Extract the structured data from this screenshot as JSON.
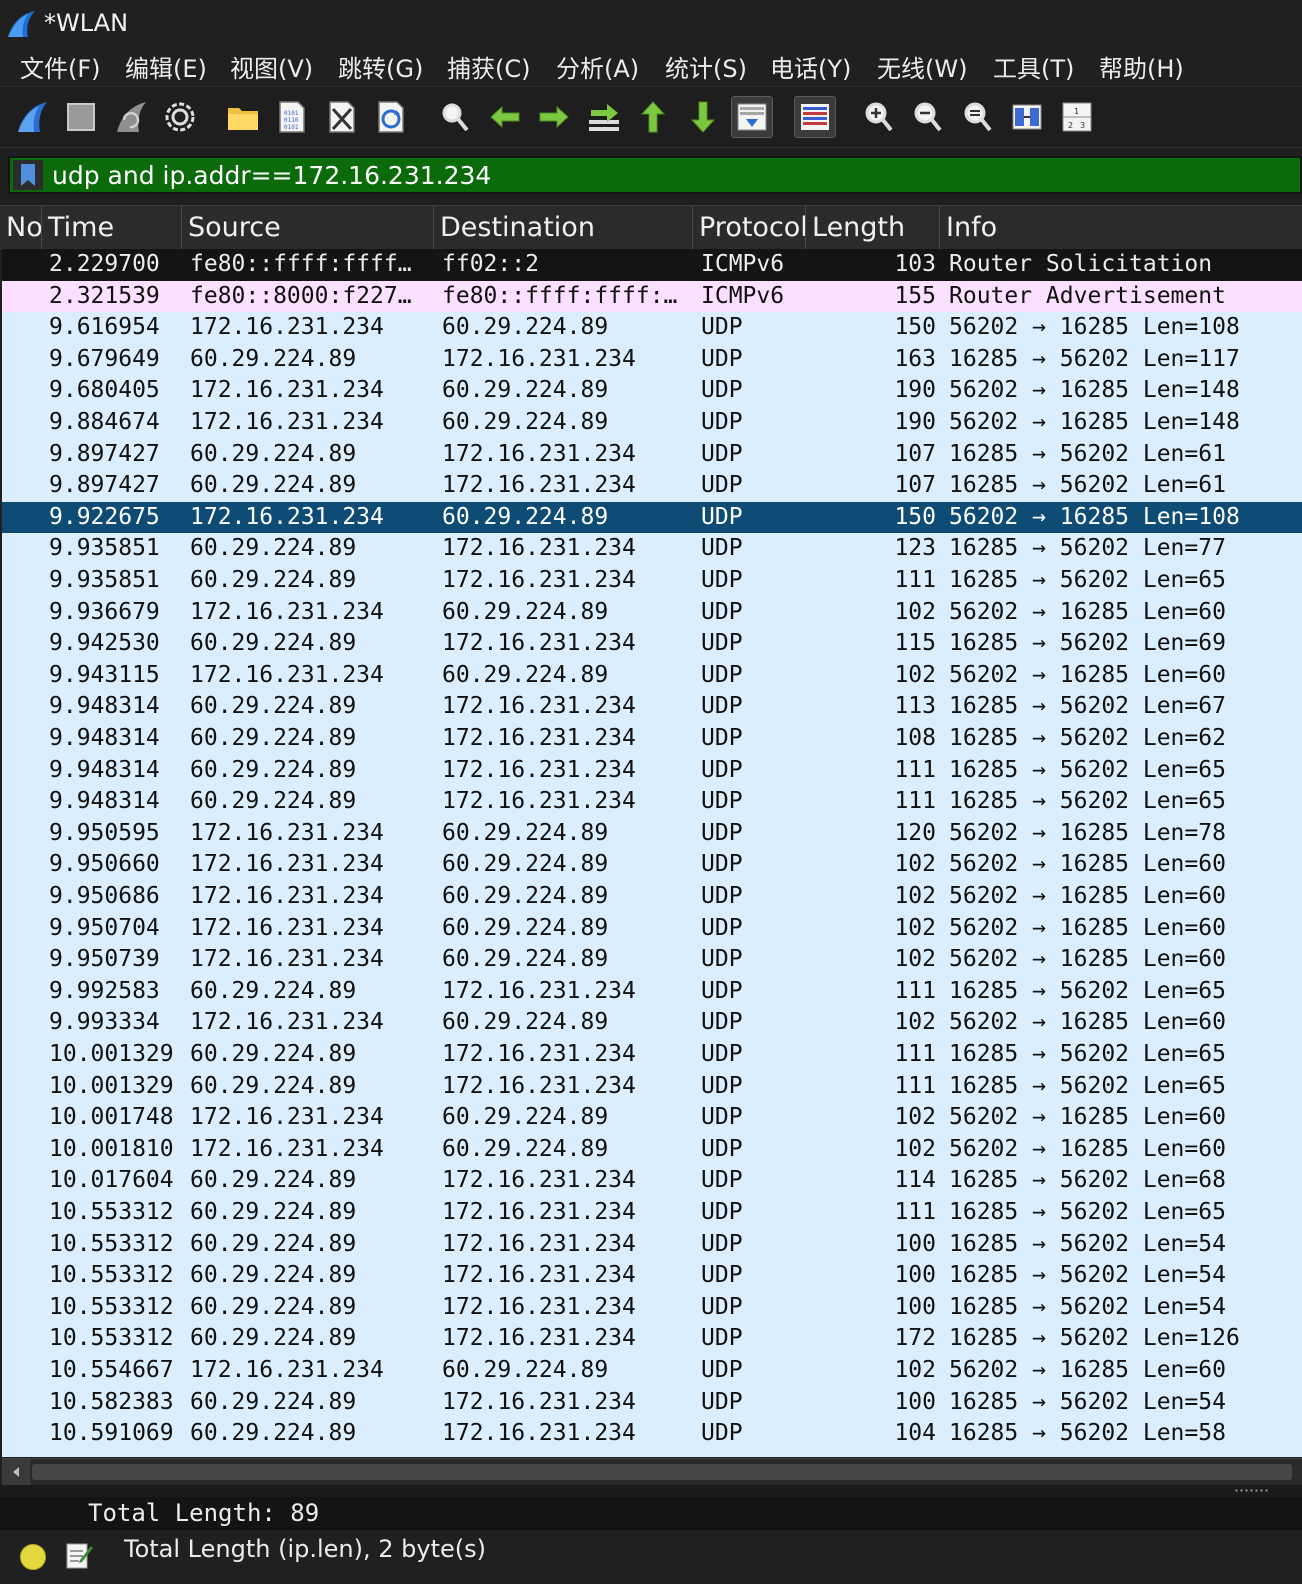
{
  "window": {
    "title": "*WLAN"
  },
  "menu": [
    "文件(F)",
    "编辑(E)",
    "视图(V)",
    "跳转(G)",
    "捕获(C)",
    "分析(A)",
    "统计(S)",
    "电话(Y)",
    "无线(W)",
    "工具(T)",
    "帮助(H)"
  ],
  "toolbar": {
    "icons": [
      "start-capture-icon",
      "stop-capture-icon",
      "restart-capture-icon",
      "capture-options-icon",
      "open-file-icon",
      "save-file-icon",
      "close-file-icon",
      "reload-file-icon",
      "find-packet-icon",
      "go-back-icon",
      "go-forward-icon",
      "go-to-packet-icon",
      "first-packet-icon",
      "last-packet-icon",
      "autoscroll-icon",
      "colorize-icon",
      "zoom-in-icon",
      "zoom-out-icon",
      "normal-size-icon",
      "resize-columns-icon",
      "packet-bytes-icon"
    ]
  },
  "filter": {
    "value": "udp and ip.addr==172.16.231.234"
  },
  "columns": {
    "no": "No",
    "time": "Time",
    "source": "Source",
    "destination": "Destination",
    "protocol": "Protocol",
    "length": "Length",
    "info": "Info"
  },
  "colors": {
    "udp_row": "#dbeefe",
    "icmp_row": "#fce0ff",
    "selected_row": "#0f4c75",
    "filter_ok": "#0b6b0b"
  },
  "packets": [
    {
      "time": "2.229700",
      "src": "fe80::ffff:ffff…",
      "dst": "ff02::2",
      "proto": "ICMPv6",
      "len": "103",
      "info": "Router Solicitation",
      "style": "dark"
    },
    {
      "time": "2.321539",
      "src": "fe80::8000:f227…",
      "dst": "fe80::ffff:ffff:…",
      "proto": "ICMPv6",
      "len": "155",
      "info": "Router Advertisement",
      "style": "icmp"
    },
    {
      "time": "9.616954",
      "src": "172.16.231.234",
      "dst": "60.29.224.89",
      "proto": "UDP",
      "len": "150",
      "info": "56202 → 16285 Len=108",
      "style": "udp"
    },
    {
      "time": "9.679649",
      "src": "60.29.224.89",
      "dst": "172.16.231.234",
      "proto": "UDP",
      "len": "163",
      "info": "16285 → 56202 Len=117",
      "style": "udp"
    },
    {
      "time": "9.680405",
      "src": "172.16.231.234",
      "dst": "60.29.224.89",
      "proto": "UDP",
      "len": "190",
      "info": "56202 → 16285 Len=148",
      "style": "udp"
    },
    {
      "time": "9.884674",
      "src": "172.16.231.234",
      "dst": "60.29.224.89",
      "proto": "UDP",
      "len": "190",
      "info": "56202 → 16285 Len=148",
      "style": "udp"
    },
    {
      "time": "9.897427",
      "src": "60.29.224.89",
      "dst": "172.16.231.234",
      "proto": "UDP",
      "len": "107",
      "info": "16285 → 56202 Len=61",
      "style": "udp"
    },
    {
      "time": "9.897427",
      "src": "60.29.224.89",
      "dst": "172.16.231.234",
      "proto": "UDP",
      "len": "107",
      "info": "16285 → 56202 Len=61",
      "style": "udp"
    },
    {
      "time": "9.922675",
      "src": "172.16.231.234",
      "dst": "60.29.224.89",
      "proto": "UDP",
      "len": "150",
      "info": "56202 → 16285 Len=108",
      "style": "selected"
    },
    {
      "time": "9.935851",
      "src": "60.29.224.89",
      "dst": "172.16.231.234",
      "proto": "UDP",
      "len": "123",
      "info": "16285 → 56202 Len=77",
      "style": "udp"
    },
    {
      "time": "9.935851",
      "src": "60.29.224.89",
      "dst": "172.16.231.234",
      "proto": "UDP",
      "len": "111",
      "info": "16285 → 56202 Len=65",
      "style": "udp"
    },
    {
      "time": "9.936679",
      "src": "172.16.231.234",
      "dst": "60.29.224.89",
      "proto": "UDP",
      "len": "102",
      "info": "56202 → 16285 Len=60",
      "style": "udp"
    },
    {
      "time": "9.942530",
      "src": "60.29.224.89",
      "dst": "172.16.231.234",
      "proto": "UDP",
      "len": "115",
      "info": "16285 → 56202 Len=69",
      "style": "udp"
    },
    {
      "time": "9.943115",
      "src": "172.16.231.234",
      "dst": "60.29.224.89",
      "proto": "UDP",
      "len": "102",
      "info": "56202 → 16285 Len=60",
      "style": "udp"
    },
    {
      "time": "9.948314",
      "src": "60.29.224.89",
      "dst": "172.16.231.234",
      "proto": "UDP",
      "len": "113",
      "info": "16285 → 56202 Len=67",
      "style": "udp"
    },
    {
      "time": "9.948314",
      "src": "60.29.224.89",
      "dst": "172.16.231.234",
      "proto": "UDP",
      "len": "108",
      "info": "16285 → 56202 Len=62",
      "style": "udp"
    },
    {
      "time": "9.948314",
      "src": "60.29.224.89",
      "dst": "172.16.231.234",
      "proto": "UDP",
      "len": "111",
      "info": "16285 → 56202 Len=65",
      "style": "udp"
    },
    {
      "time": "9.948314",
      "src": "60.29.224.89",
      "dst": "172.16.231.234",
      "proto": "UDP",
      "len": "111",
      "info": "16285 → 56202 Len=65",
      "style": "udp"
    },
    {
      "time": "9.950595",
      "src": "172.16.231.234",
      "dst": "60.29.224.89",
      "proto": "UDP",
      "len": "120",
      "info": "56202 → 16285 Len=78",
      "style": "udp"
    },
    {
      "time": "9.950660",
      "src": "172.16.231.234",
      "dst": "60.29.224.89",
      "proto": "UDP",
      "len": "102",
      "info": "56202 → 16285 Len=60",
      "style": "udp"
    },
    {
      "time": "9.950686",
      "src": "172.16.231.234",
      "dst": "60.29.224.89",
      "proto": "UDP",
      "len": "102",
      "info": "56202 → 16285 Len=60",
      "style": "udp"
    },
    {
      "time": "9.950704",
      "src": "172.16.231.234",
      "dst": "60.29.224.89",
      "proto": "UDP",
      "len": "102",
      "info": "56202 → 16285 Len=60",
      "style": "udp"
    },
    {
      "time": "9.950739",
      "src": "172.16.231.234",
      "dst": "60.29.224.89",
      "proto": "UDP",
      "len": "102",
      "info": "56202 → 16285 Len=60",
      "style": "udp"
    },
    {
      "time": "9.992583",
      "src": "60.29.224.89",
      "dst": "172.16.231.234",
      "proto": "UDP",
      "len": "111",
      "info": "16285 → 56202 Len=65",
      "style": "udp"
    },
    {
      "time": "9.993334",
      "src": "172.16.231.234",
      "dst": "60.29.224.89",
      "proto": "UDP",
      "len": "102",
      "info": "56202 → 16285 Len=60",
      "style": "udp"
    },
    {
      "time": "10.001329",
      "src": "60.29.224.89",
      "dst": "172.16.231.234",
      "proto": "UDP",
      "len": "111",
      "info": "16285 → 56202 Len=65",
      "style": "udp"
    },
    {
      "time": "10.001329",
      "src": "60.29.224.89",
      "dst": "172.16.231.234",
      "proto": "UDP",
      "len": "111",
      "info": "16285 → 56202 Len=65",
      "style": "udp"
    },
    {
      "time": "10.001748",
      "src": "172.16.231.234",
      "dst": "60.29.224.89",
      "proto": "UDP",
      "len": "102",
      "info": "56202 → 16285 Len=60",
      "style": "udp"
    },
    {
      "time": "10.001810",
      "src": "172.16.231.234",
      "dst": "60.29.224.89",
      "proto": "UDP",
      "len": "102",
      "info": "56202 → 16285 Len=60",
      "style": "udp"
    },
    {
      "time": "10.017604",
      "src": "60.29.224.89",
      "dst": "172.16.231.234",
      "proto": "UDP",
      "len": "114",
      "info": "16285 → 56202 Len=68",
      "style": "udp"
    },
    {
      "time": "10.553312",
      "src": "60.29.224.89",
      "dst": "172.16.231.234",
      "proto": "UDP",
      "len": "111",
      "info": "16285 → 56202 Len=65",
      "style": "udp"
    },
    {
      "time": "10.553312",
      "src": "60.29.224.89",
      "dst": "172.16.231.234",
      "proto": "UDP",
      "len": "100",
      "info": "16285 → 56202 Len=54",
      "style": "udp"
    },
    {
      "time": "10.553312",
      "src": "60.29.224.89",
      "dst": "172.16.231.234",
      "proto": "UDP",
      "len": "100",
      "info": "16285 → 56202 Len=54",
      "style": "udp"
    },
    {
      "time": "10.553312",
      "src": "60.29.224.89",
      "dst": "172.16.231.234",
      "proto": "UDP",
      "len": "100",
      "info": "16285 → 56202 Len=54",
      "style": "udp"
    },
    {
      "time": "10.553312",
      "src": "60.29.224.89",
      "dst": "172.16.231.234",
      "proto": "UDP",
      "len": "172",
      "info": "16285 → 56202 Len=126",
      "style": "udp"
    },
    {
      "time": "10.554667",
      "src": "172.16.231.234",
      "dst": "60.29.224.89",
      "proto": "UDP",
      "len": "102",
      "info": "56202 → 16285 Len=60",
      "style": "udp"
    },
    {
      "time": "10.582383",
      "src": "60.29.224.89",
      "dst": "172.16.231.234",
      "proto": "UDP",
      "len": "100",
      "info": "16285 → 56202 Len=54",
      "style": "udp"
    },
    {
      "time": "10.591069",
      "src": "60.29.224.89",
      "dst": "172.16.231.234",
      "proto": "UDP",
      "len": "104",
      "info": "16285 → 56202 Len=58",
      "style": "udp"
    }
  ],
  "details": {
    "line": "Total Length: 89"
  },
  "status": {
    "text": "Total Length (ip.len), 2 byte(s)"
  }
}
